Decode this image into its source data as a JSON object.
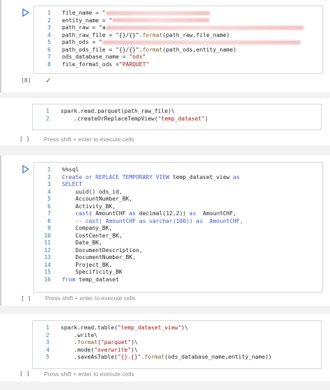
{
  "cells": [
    {
      "exec_count": "[8]",
      "status": "✓",
      "lines": [
        {
          "n": "1",
          "parts": [
            {
              "t": "file_name = \"",
              "c": "plain"
            },
            {
              "t": "",
              "c": "blur",
              "w": 150
            }
          ]
        },
        {
          "n": "2",
          "parts": [
            {
              "t": "entity_name = \"",
              "c": "plain"
            },
            {
              "t": "",
              "c": "blur",
              "w": 140
            }
          ]
        },
        {
          "n": "3",
          "parts": [
            {
              "t": "path_raw = \"a",
              "c": "plain"
            },
            {
              "t": "",
              "c": "blur",
              "w": 285
            }
          ]
        },
        {
          "n": "4",
          "parts": [
            {
              "t": "path_raw_file = \"{}/{}\".",
              "c": "plain"
            },
            {
              "t": "format",
              "c": "fn"
            },
            {
              "t": "(path_raw,file_name)",
              "c": "plain"
            }
          ]
        },
        {
          "n": "5",
          "parts": [
            {
              "t": "path_ods = \"",
              "c": "plain"
            },
            {
              "t": "",
              "c": "blur",
              "w": 285
            }
          ]
        },
        {
          "n": "6",
          "parts": [
            {
              "t": "path_ods_file = \"{}/{}\".",
              "c": "plain"
            },
            {
              "t": "format",
              "c": "fn"
            },
            {
              "t": "(path_ods,entity_name)",
              "c": "plain"
            }
          ]
        },
        {
          "n": "7",
          "parts": [
            {
              "t": "ods_database_name = ",
              "c": "plain"
            },
            {
              "t": "\"ods\"",
              "c": "str"
            }
          ]
        },
        {
          "n": "8",
          "parts": [
            {
              "t": "file_format_ods =",
              "c": "plain"
            },
            {
              "t": "\"PARQUET\"",
              "c": "str"
            }
          ]
        }
      ]
    },
    {
      "exec_count": "[ ]",
      "hint": "Press shift + enter to execute cells",
      "lines": [
        {
          "n": "1",
          "parts": [
            {
              "t": "spark.read.parquet(path_raw_file)\\",
              "c": "plain"
            }
          ]
        },
        {
          "n": "2",
          "parts": [
            {
              "t": "    .createOrReplaceTempView(",
              "c": "plain"
            },
            {
              "t": "\"temp_dataset\"",
              "c": "str"
            },
            {
              "t": ")",
              "c": "plain"
            }
          ]
        }
      ]
    },
    {
      "exec_count": "[ ]",
      "hint": "Press shift + enter to execute cells",
      "lines": [
        {
          "n": "1",
          "parts": [
            {
              "t": "%%sql",
              "c": "plain"
            }
          ]
        },
        {
          "n": "2",
          "parts": [
            {
              "t": "Create or REPLACE TEMPORARY VIEW",
              "c": "kw"
            },
            {
              "t": " temp_dataset_view ",
              "c": "plain"
            },
            {
              "t": "as",
              "c": "kw"
            }
          ]
        },
        {
          "n": "3",
          "parts": [
            {
              "t": "SELECT",
              "c": "kw"
            }
          ]
        },
        {
          "n": "4",
          "parts": [
            {
              "t": "    uuid() ods_id,",
              "c": "plain"
            }
          ]
        },
        {
          "n": "5",
          "parts": [
            {
              "t": "    AccountNumber_BK,",
              "c": "plain"
            }
          ]
        },
        {
          "n": "6",
          "parts": [
            {
              "t": "    Activity_BK,",
              "c": "plain"
            }
          ]
        },
        {
          "n": "7",
          "parts": [
            {
              "t": "    ",
              "c": "plain"
            },
            {
              "t": "cast",
              "c": "kw"
            },
            {
              "t": "( AmountCHF ",
              "c": "plain"
            },
            {
              "t": "as",
              "c": "kw"
            },
            {
              "t": " decimal(12,2)) ",
              "c": "plain"
            },
            {
              "t": "as",
              "c": "kw"
            },
            {
              "t": "  AmountCHF,",
              "c": "plain"
            }
          ]
        },
        {
          "n": "8",
          "parts": [
            {
              "t": "    -- cast( AmountCHF as varchar(100)) as  AmountCHF,",
              "c": "kw"
            }
          ]
        },
        {
          "n": "9",
          "parts": [
            {
              "t": "    Company_BK,",
              "c": "plain"
            }
          ]
        },
        {
          "n": "10",
          "parts": [
            {
              "t": "    CostCenter_BK,",
              "c": "plain"
            }
          ]
        },
        {
          "n": "11",
          "parts": [
            {
              "t": "    Date_BK,",
              "c": "plain"
            }
          ]
        },
        {
          "n": "12",
          "parts": [
            {
              "t": "    DocumentDescription,",
              "c": "plain"
            }
          ]
        },
        {
          "n": "13",
          "parts": [
            {
              "t": "    DocumentNumber_BK,",
              "c": "plain"
            }
          ]
        },
        {
          "n": "14",
          "parts": [
            {
              "t": "    Project_BK,",
              "c": "plain"
            }
          ]
        },
        {
          "n": "15",
          "parts": [
            {
              "t": "    Specificity_BK",
              "c": "plain"
            }
          ]
        },
        {
          "n": "16",
          "parts": [
            {
              "t": "from",
              "c": "kw"
            },
            {
              "t": " temp_dataset",
              "c": "plain"
            }
          ]
        }
      ]
    },
    {
      "exec_count": "[ ]",
      "hint": "Press shift + enter to execute cells",
      "lines": [
        {
          "n": "1",
          "parts": [
            {
              "t": "spark.read.table(",
              "c": "plain"
            },
            {
              "t": "\"temp_dataset_view\"",
              "c": "str"
            },
            {
              "t": ")\\",
              "c": "plain"
            }
          ]
        },
        {
          "n": "2",
          "parts": [
            {
              "t": "    .write\\",
              "c": "plain"
            }
          ]
        },
        {
          "n": "3",
          "parts": [
            {
              "t": "    .",
              "c": "plain"
            },
            {
              "t": "format",
              "c": "fn"
            },
            {
              "t": "(",
              "c": "plain"
            },
            {
              "t": "\"parquet\"",
              "c": "str"
            },
            {
              "t": ")\\",
              "c": "plain"
            }
          ]
        },
        {
          "n": "4",
          "parts": [
            {
              "t": "    .mode(",
              "c": "plain"
            },
            {
              "t": "\"overwrite\"",
              "c": "str"
            },
            {
              "t": ")\\",
              "c": "plain"
            }
          ]
        },
        {
          "n": "5",
          "parts": [
            {
              "t": "    .saveAsTable(",
              "c": "plain"
            },
            {
              "t": "\"{}.{}\"",
              "c": "str"
            },
            {
              "t": ".",
              "c": "plain"
            },
            {
              "t": "format",
              "c": "fn"
            },
            {
              "t": "(ods_database_name,entity_name))",
              "c": "plain"
            }
          ]
        }
      ]
    }
  ]
}
